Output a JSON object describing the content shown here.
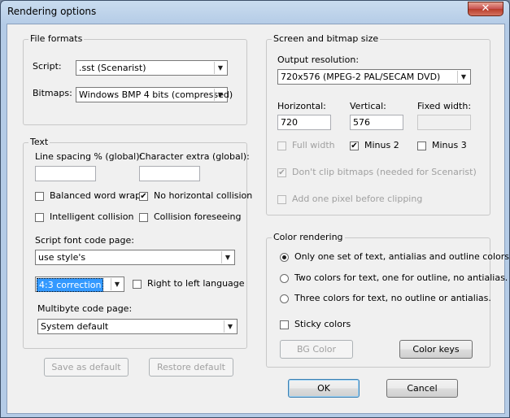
{
  "window": {
    "title": "Rendering options",
    "close_glyph": "✕"
  },
  "file_formats": {
    "label": "File formats",
    "script_label": "Script:",
    "script_value": ".sst (Scenarist)",
    "bitmaps_label": "Bitmaps:",
    "bitmaps_value": "Windows BMP 4 bits (compressed)"
  },
  "text": {
    "label": "Text",
    "line_spacing_label": "Line spacing % (global):",
    "line_spacing_value": "",
    "char_extra_label": "Character extra (global):",
    "char_extra_value": "",
    "balanced_word_wrap": {
      "label": "Balanced word wrap",
      "checked": false
    },
    "no_horizontal_collision": {
      "label": "No horizontal collision",
      "checked": true
    },
    "intelligent_collision": {
      "label": "Intelligent collision",
      "checked": false
    },
    "collision_foreseeing": {
      "label": "Collision foreseeing",
      "checked": false
    },
    "script_font_code_page_label": "Script font code page:",
    "script_font_code_page_value": "use style's",
    "correction_value": "4:3 correction",
    "right_to_left": {
      "label": "Right to left language",
      "checked": false
    },
    "multibyte_code_page_label": "Multibyte code page:",
    "multibyte_code_page_value": "System default"
  },
  "screen": {
    "label": "Screen and bitmap size",
    "output_resolution_label": "Output resolution:",
    "output_resolution_value": "720x576 (MPEG-2 PAL/SECAM DVD)",
    "horizontal_label": "Horizontal:",
    "horizontal_value": "720",
    "vertical_label": "Vertical:",
    "vertical_value": "576",
    "fixed_width_label": "Fixed width:",
    "fixed_width_value": "",
    "full_width": {
      "label": "Full width",
      "checked": false
    },
    "minus_2": {
      "label": "Minus 2",
      "checked": true
    },
    "minus_3": {
      "label": "Minus 3",
      "checked": false
    },
    "dont_clip": {
      "label": "Don't clip bitmaps (needed for Scenarist)",
      "checked": true
    },
    "add_one_pixel": {
      "label": "Add one pixel before clipping",
      "checked": false
    }
  },
  "color": {
    "label": "Color rendering",
    "option_1": "Only one set of text, antialias and outline colors.",
    "option_2": "Two colors for text, one for outline, no antialias.",
    "option_3": "Three colors for text, no outline or antialias.",
    "selected_option": 1,
    "sticky_colors": {
      "label": "Sticky colors",
      "checked": false
    },
    "bg_color_label": "BG Color",
    "color_keys_label": "Color keys"
  },
  "buttons": {
    "save_as_default": "Save as default",
    "restore_default": "Restore default",
    "ok": "OK",
    "cancel": "Cancel"
  },
  "glyphs": {
    "check": "✔",
    "dropdown": "▼"
  }
}
